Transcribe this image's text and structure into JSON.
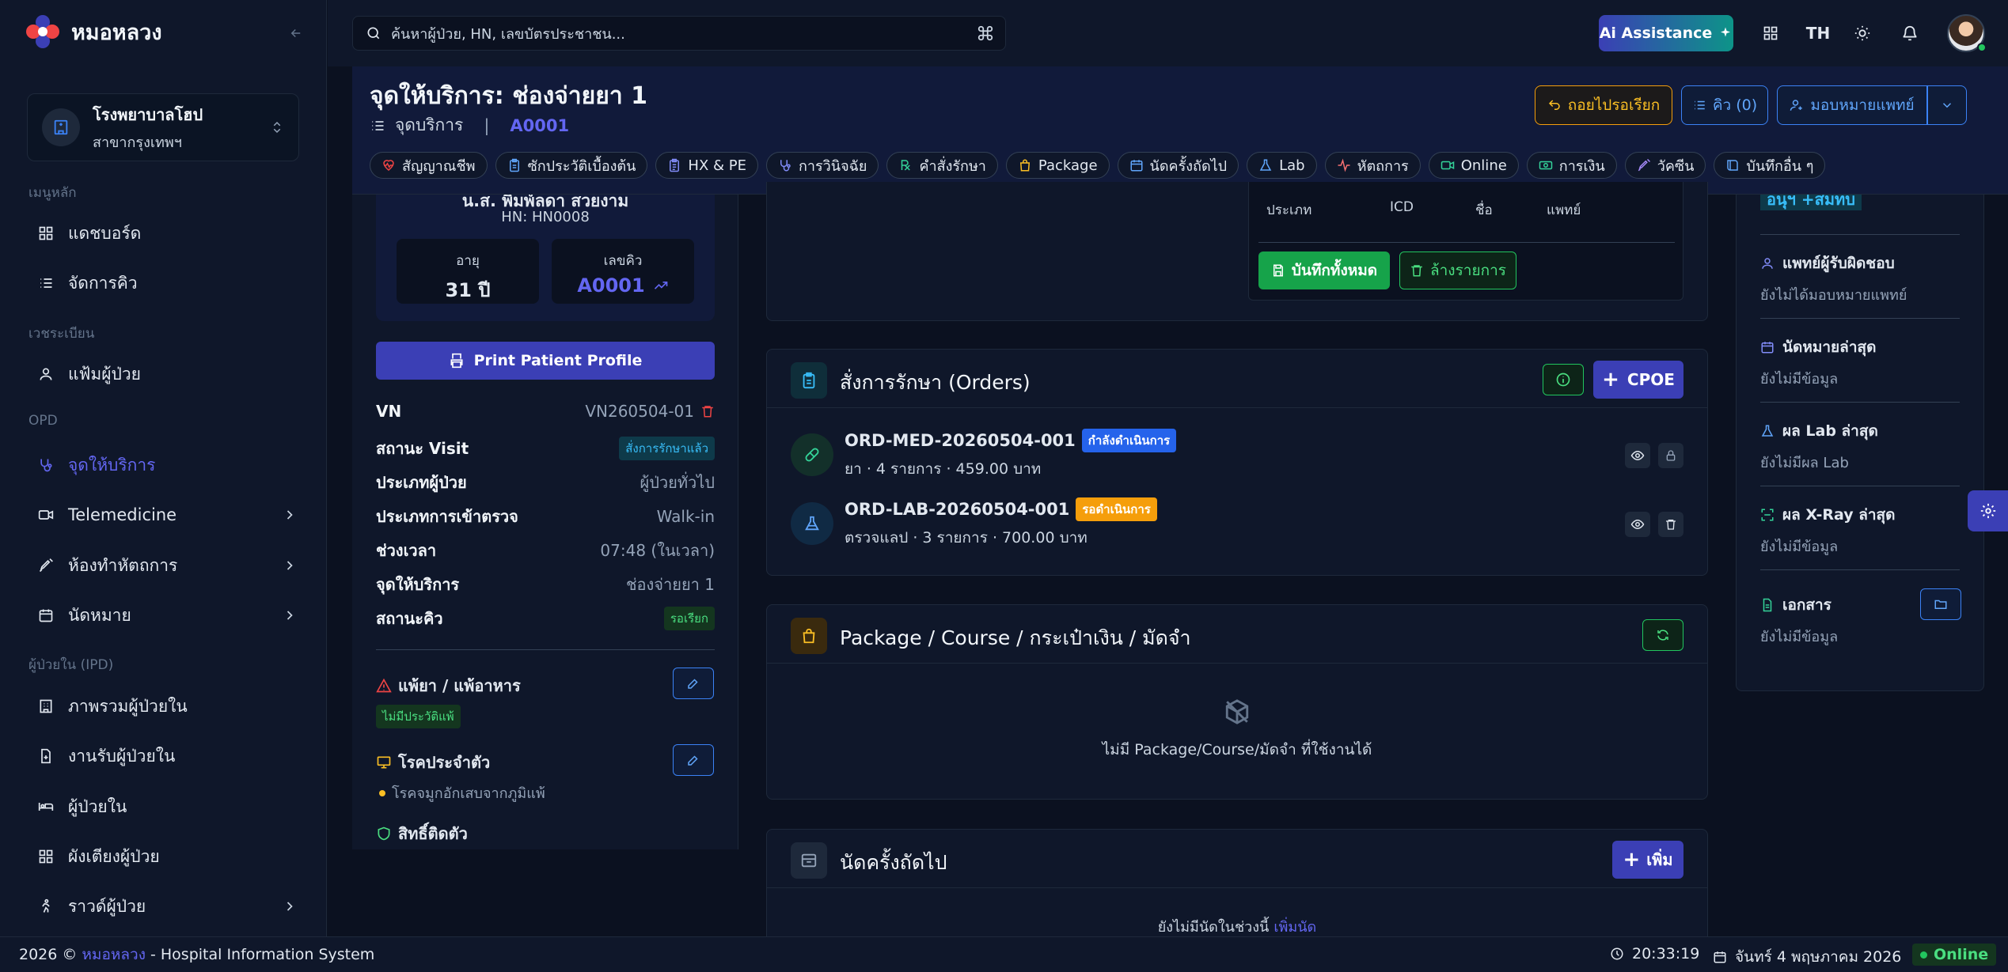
{
  "app": {
    "name": "หมอหลวง"
  },
  "colors": {
    "accent": "#3b3fb5",
    "success": "#16a34a",
    "warning": "#f59e0b",
    "info": "#2563eb",
    "danger": "#ef4444"
  },
  "sidebar": {
    "org": {
      "name": "โรงพยาบาลโฮป",
      "branch": "สาขากรุงเทพฯ"
    },
    "sections": [
      {
        "label": "เมนูหลัก"
      },
      {
        "label": "เวชระเบียน"
      },
      {
        "label": "OPD"
      },
      {
        "label": "ผู้ป่วยใน (IPD)"
      }
    ],
    "items": [
      {
        "label": "แดชบอร์ด",
        "icon": "dashboard-icon"
      },
      {
        "label": "จัดการคิว",
        "icon": "list-icon"
      },
      {
        "label": "แฟ้มผู้ป่วย",
        "icon": "user-icon"
      },
      {
        "label": "จุดให้บริการ",
        "icon": "stethoscope-icon"
      },
      {
        "label": "Telemedicine",
        "icon": "video-icon"
      },
      {
        "label": "ห้องทำหัตถการ",
        "icon": "syringe-icon"
      },
      {
        "label": "นัดหมาย",
        "icon": "calendar-icon"
      },
      {
        "label": "ภาพรวมผู้ป่วยใน",
        "icon": "building-icon"
      },
      {
        "label": "งานรับผู้ป่วยใน",
        "icon": "file-plus-icon"
      },
      {
        "label": "ผู้ป่วยใน",
        "icon": "bed-icon"
      },
      {
        "label": "ผังเตียงผู้ป่วย",
        "icon": "grid-icon"
      },
      {
        "label": "ราวด์ผู้ป่วย",
        "icon": "walk-icon"
      }
    ]
  },
  "topbar": {
    "search_placeholder": "ค้นหาผู้ป่วย, HN, เลขบัตรประชาชน...",
    "ai_label": "Ai Assistance",
    "lang": "TH"
  },
  "header": {
    "title": "จุดให้บริการ: ช่องจ่ายยา 1",
    "breadcrumb": "จุดบริการ",
    "queue": "A0001",
    "back_label": "ถอยไปรอเรียก",
    "queue_btn": "คิว (0)",
    "assign_label": "มอบหมายแพทย์",
    "tabs": [
      {
        "label": "สัญญาณชีพ",
        "icon": "heart-pulse-icon",
        "color": "#ef4444"
      },
      {
        "label": "ซักประวัติเบื้องต้น",
        "icon": "clipboard-icon",
        "color": "#60a5fa"
      },
      {
        "label": "HX & PE",
        "icon": "clipboard-list-icon",
        "color": "#818cf8"
      },
      {
        "label": "การวินิจฉัย",
        "icon": "stethoscope-icon",
        "color": "#818cf8"
      },
      {
        "label": "คำสั่งรักษา",
        "icon": "rx-icon",
        "color": "#34d399"
      },
      {
        "label": "Package",
        "icon": "bag-icon",
        "color": "#fbbf24"
      },
      {
        "label": "นัดครั้งถัดไป",
        "icon": "calendar-icon",
        "color": "#60a5fa"
      },
      {
        "label": "Lab",
        "icon": "flask-icon",
        "color": "#60a5fa"
      },
      {
        "label": "หัตถการ",
        "icon": "activity-icon",
        "color": "#f87171"
      },
      {
        "label": "Online",
        "icon": "video-icon",
        "color": "#34d399"
      },
      {
        "label": "การเงิน",
        "icon": "money-icon",
        "color": "#34d399"
      },
      {
        "label": "วัคซีน",
        "icon": "syringe-icon",
        "color": "#a78bfa"
      },
      {
        "label": "บันทึกอื่น ๆ",
        "icon": "book-icon",
        "color": "#60a5fa"
      }
    ]
  },
  "patient": {
    "name": "น.ส. พิมพ์ลดา สวยงาม",
    "hn": "HN: HN0008",
    "age_label": "อายุ",
    "age": "31 ปี",
    "queue_label": "เลขคิว",
    "queue": "A0001",
    "print_label": "Print Patient Profile",
    "rows": [
      {
        "k": "VN",
        "v": "VN260504-01"
      },
      {
        "k": "สถานะ Visit",
        "v": "สั่งการรักษาแล้ว"
      },
      {
        "k": "ประเภทผู้ป่วย",
        "v": "ผู้ป่วยทั่วไป"
      },
      {
        "k": "ประเภทการเข้าตรวจ",
        "v": "Walk-in"
      },
      {
        "k": "ช่วงเวลา",
        "v": "07:48 (ในเวลา)"
      },
      {
        "k": "จุดให้บริการ",
        "v": "ช่องจ่ายยา 1"
      },
      {
        "k": "สถานะคิว",
        "v": "รอเรียก"
      }
    ],
    "allergy_title": "แพ้ยา / แพ้อาหาร",
    "allergy_badge": "ไม่มีประวัติแพ้",
    "disease_title": "โรคประจำตัว",
    "disease_item": "โรคจมูกอักเสบจากภูมิแพ้",
    "rights_title": "สิทธิ์ติดตัว"
  },
  "diagnosis": {
    "cols": [
      "ประเภท",
      "ICD",
      "ชื่อ",
      "แพทย์"
    ],
    "save_label": "บันทึกทั้งหมด",
    "clear_label": "ล้างรายการ"
  },
  "orders": {
    "title": "สั่งการรักษา (Orders)",
    "cpoe_label": "CPOE",
    "items": [
      {
        "id": "ORD-MED-20260504-001",
        "status": "กำลังดำเนินการ",
        "detail": "ยา · 4 รายการ · 459.00 บาท"
      },
      {
        "id": "ORD-LAB-20260504-001",
        "status": "รอดำเนินการ",
        "detail": "ตรวจแลป · 3 รายการ · 700.00 บาท"
      }
    ]
  },
  "package": {
    "title": "Package / Course / กระเป๋าเงิน / มัดจำ",
    "empty": "ไม่มี Package/Course/มัดจำ ที่ใช้งานได้"
  },
  "appointment": {
    "title": "นัดครั้งถัดไป",
    "add_label": "เพิ่ม",
    "empty": "ยังไม่มีนัดในช่วงนี้",
    "add_link": "เพิ่มนัด"
  },
  "right_panel": {
    "top_tag": "อนุฯ +สมทบ",
    "items": [
      {
        "title": "แพทย์ผู้รับผิดชอบ",
        "value": "ยังไม่ได้มอบหมายแพทย์",
        "icon": "user-icon"
      },
      {
        "title": "นัดหมายล่าสุด",
        "value": "ยังไม่มีข้อมูล",
        "icon": "calendar-icon"
      },
      {
        "title": "ผล Lab ล่าสุด",
        "value": "ยังไม่มีผล Lab",
        "icon": "flask-icon"
      },
      {
        "title": "ผล X-Ray ล่าสุด",
        "value": "ยังไม่มีข้อมูล",
        "icon": "scan-icon"
      },
      {
        "title": "เอกสาร",
        "value": "ยังไม่มีข้อมูล",
        "icon": "doc-icon"
      }
    ]
  },
  "footer": {
    "year": "2026 ©",
    "brand": "หมอหลวง",
    "suffix": "- Hospital Information System",
    "time": "20:33:19",
    "date": "จันทร์ 4 พฤษภาคม 2026",
    "status": "Online"
  }
}
